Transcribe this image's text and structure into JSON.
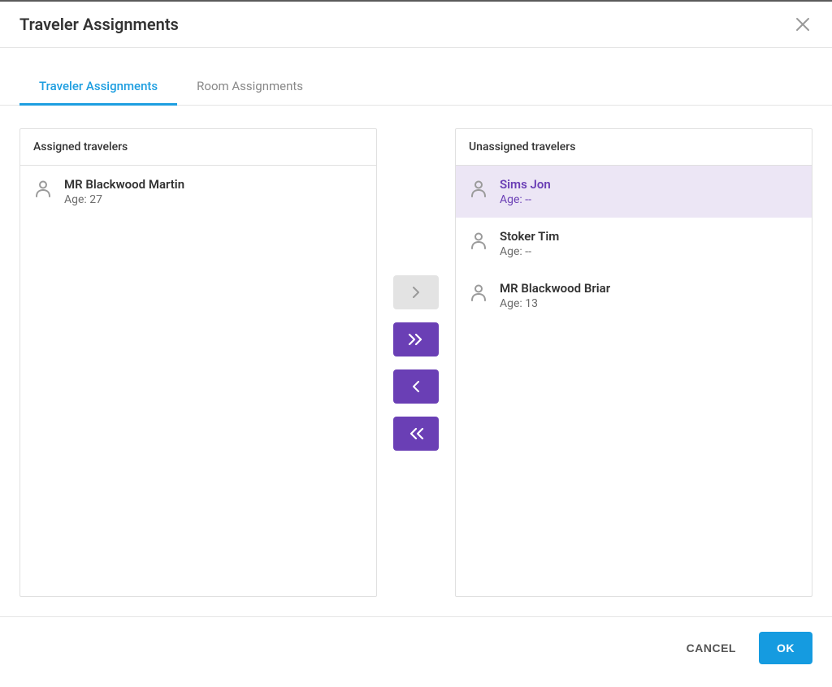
{
  "dialog": {
    "title": "Traveler Assignments"
  },
  "tabs": [
    {
      "label": "Traveler Assignments",
      "active": true
    },
    {
      "label": "Room Assignments",
      "active": false
    }
  ],
  "panels": {
    "assigned": {
      "title": "Assigned travelers",
      "items": [
        {
          "name": "MR Blackwood Martin",
          "age_label": "Age: 27",
          "selected": false
        }
      ]
    },
    "unassigned": {
      "title": "Unassigned travelers",
      "items": [
        {
          "name": "Sims Jon",
          "age_label": "Age: --",
          "selected": true
        },
        {
          "name": "Stoker Tim",
          "age_label": "Age: --",
          "selected": false
        },
        {
          "name": "MR Blackwood Briar",
          "age_label": "Age: 13",
          "selected": false
        }
      ]
    }
  },
  "transfer": {
    "move_right_disabled": true
  },
  "footer": {
    "cancel": "CANCEL",
    "ok": "OK"
  }
}
